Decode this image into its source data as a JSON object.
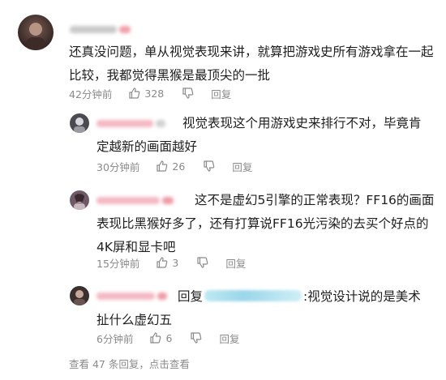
{
  "comment": {
    "text_line1": "还真没问题，单从视觉表现来讲，就算把游戏史所有游戏拿在一起",
    "text_line2": "比较，我都觉得黑猴是最顶尖的一批",
    "time": "42分钟前",
    "likes": "328",
    "reply_label": "回复"
  },
  "replies": [
    {
      "text_line1": "视觉表现这个用游戏史来排行不对，毕竟肯",
      "text_line2": "定越新的画面越好",
      "time": "30分钟前",
      "likes": "26",
      "reply_label": "回复"
    },
    {
      "text_line1": "这不是虚幻5引擎的正常表现？FF16的画面",
      "text_line2": "表现比黑猴好多了，还有打算说FF16光污染的去买个好点的",
      "text_line3": "4K屏和显卡吧",
      "time": "15分钟前",
      "likes": "3",
      "reply_label": "回复"
    },
    {
      "prefix": "回复",
      "text_line1_tail": ":视觉设计说的是美术",
      "text_line2": "扯什么虚幻五",
      "time": "6分钟前",
      "likes": "6",
      "reply_label": "回复"
    }
  ],
  "more_replies": "查看 47 条回复，点击查看",
  "icons": {
    "like": "thumbs-up-icon",
    "dislike": "thumbs-down-icon"
  }
}
